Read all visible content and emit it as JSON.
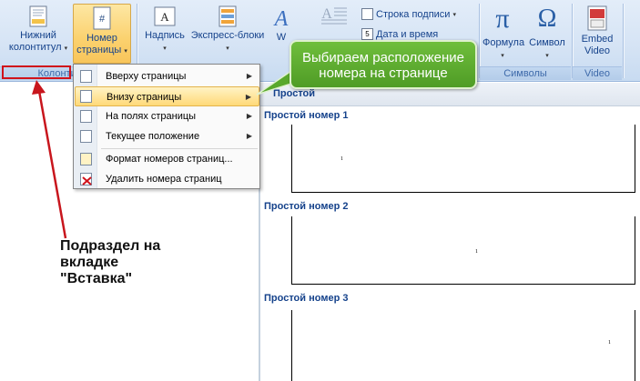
{
  "ribbon": {
    "header_footer_group": {
      "footer_label": "Нижний колонтитул",
      "page_number_label": "Номер страницы",
      "group_label": "Колонтитулы"
    },
    "text_group": {
      "textbox_label": "Надпись",
      "quickparts_label": "Экспресс-блоки",
      "wordart_label": "W",
      "signature_line_label": "Строка подписи",
      "datetime_label": "Дата и время"
    },
    "symbols_group": {
      "formula_label": "Формула",
      "symbol_label": "Символ",
      "group_label": "Символы",
      "formula_glyph": "π",
      "symbol_glyph": "Ω"
    },
    "video_group": {
      "embed_label": "Embed Video",
      "group_label": "Video"
    }
  },
  "menu": {
    "items": [
      {
        "label": "Вверху страницы",
        "submenu": true
      },
      {
        "label": "Внизу страницы",
        "submenu": true,
        "highlighted": true
      },
      {
        "label": "На полях страницы",
        "submenu": true
      },
      {
        "label": "Текущее положение",
        "submenu": true
      },
      {
        "label": "Формат номеров страниц...",
        "submenu": false
      },
      {
        "label": "Удалить номера страниц",
        "submenu": false
      }
    ]
  },
  "gallery": {
    "header": "Простой",
    "items": [
      {
        "title": "Простой номер 1",
        "number": "1"
      },
      {
        "title": "Простой номер 2",
        "number": "1"
      },
      {
        "title": "Простой номер 3",
        "number": "1"
      }
    ]
  },
  "callout": {
    "text": "Выбираем расположение номера на странице"
  },
  "annotation": {
    "text": "Подраздел на вкладке \"Вставка\""
  },
  "colors": {
    "accent_red": "#d0121b",
    "callout_green": "#5aa82e",
    "ribbon_text": "#15428b"
  }
}
